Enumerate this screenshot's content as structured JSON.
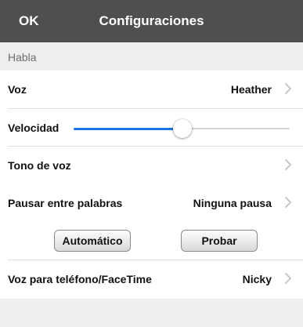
{
  "navbar": {
    "ok_label": "OK",
    "title": "Configuraciones"
  },
  "section_habla": {
    "label": "Habla"
  },
  "rows": {
    "voz": {
      "label": "Voz",
      "value": "Heather"
    },
    "velocidad": {
      "label": "Velocidad",
      "level": 0.5
    },
    "tono": {
      "label": "Tono de voz"
    },
    "pausar": {
      "label": "Pausar entre palabras",
      "value": "Ninguna pausa"
    },
    "voz_telefono": {
      "label": "Voz para teléfono/FaceTime",
      "value": "Nicky"
    }
  },
  "buttons": {
    "automatico": "Automático",
    "probar": "Probar"
  },
  "colors": {
    "navbar": "#4f4f4f",
    "slider_fill": "#1a73e8",
    "section_bg": "#eeeeee"
  },
  "icons": [
    "chevron-right-icon"
  ]
}
